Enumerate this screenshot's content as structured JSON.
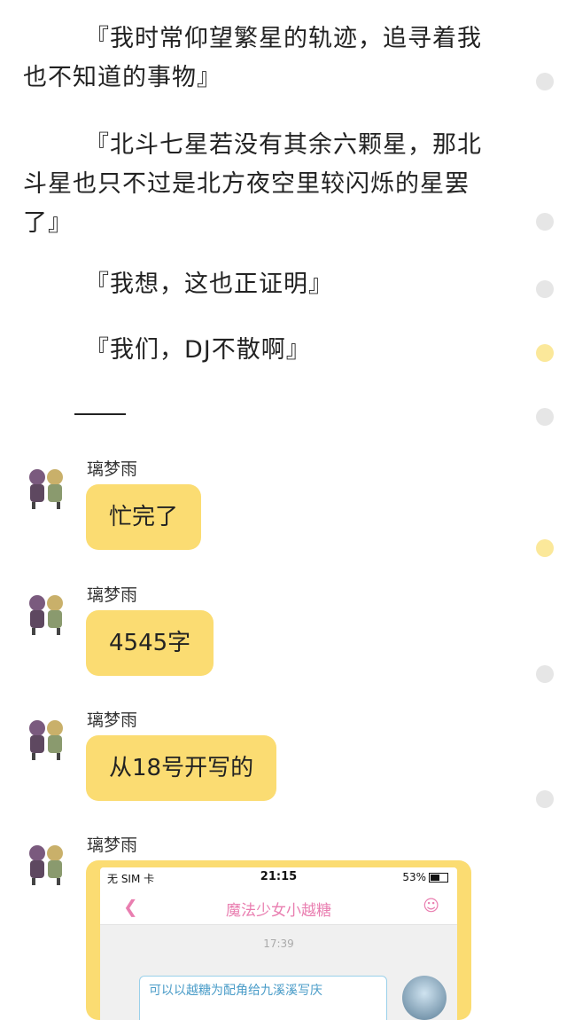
{
  "paragraphs": [
    "『我时常仰望繁星的轨迹，追寻着我也不知道的事物』",
    "『北斗七星若没有其余六颗星，那北斗星也只不过是北方夜空里较闪烁的星罢了』",
    "『我想，这也正证明』",
    "『我们，DJ不散啊』"
  ],
  "messages": [
    {
      "sender": "璃梦雨",
      "text": "忙完了"
    },
    {
      "sender": "璃梦雨",
      "text": "4545字"
    },
    {
      "sender": "璃梦雨",
      "text": "从18号开写的"
    },
    {
      "sender": "璃梦雨"
    }
  ],
  "screenshot": {
    "carrier": "无 SIM 卡",
    "time": "21:15",
    "battery": "53%",
    "title": "魔法少女小越糖",
    "chat_time": "17:39",
    "message": "可以以越糖为配角给九溪溪写庆",
    "back_icon": "chevron-left-icon",
    "person_icon": "person-icon"
  },
  "colors": {
    "bubble": "#fbdc72",
    "accent_pink": "#e97eb0",
    "dot_yellow": "#fbe89a",
    "dot_gray": "#e6e6e6"
  }
}
